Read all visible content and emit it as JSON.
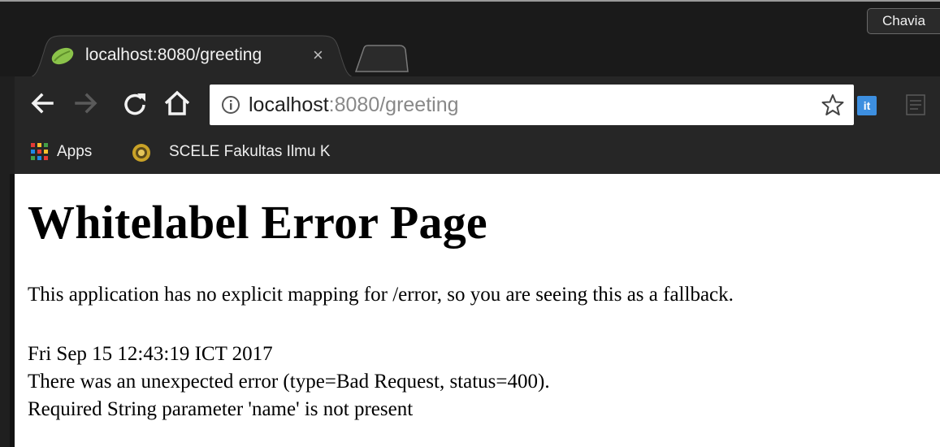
{
  "browser": {
    "profile_name": "Chavia",
    "tab": {
      "title": "localhost:8080/greeting",
      "close_glyph": "×",
      "favicon": "spring-leaf-icon"
    },
    "address_bar": {
      "host": "localhost",
      "path": ":8080/greeting"
    },
    "bookmarks": [
      {
        "label": "Apps",
        "icon": "apps-grid-icon"
      },
      {
        "label": "SCELE Fakultas Ilmu K",
        "icon": "university-seal-icon"
      }
    ],
    "extensions": {
      "it_label": "it"
    }
  },
  "page": {
    "heading": "Whitelabel Error Page",
    "message": "This application has no explicit mapping for /error, so you are seeing this as a fallback.",
    "timestamp": "Fri Sep 15 12:43:19 ICT 2017",
    "error_line": "There was an unexpected error (type=Bad Request, status=400).",
    "detail": "Required String parameter 'name' is not present"
  },
  "colors": {
    "accent_leaf": "#8bc34a",
    "frame": "#1a1a1a",
    "toolbar": "#262626"
  }
}
